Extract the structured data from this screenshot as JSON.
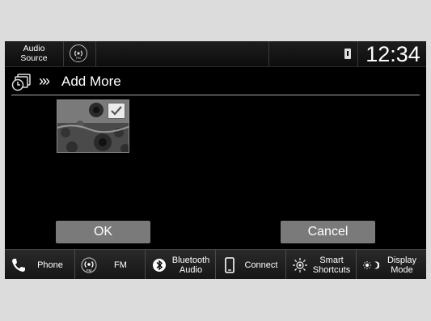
{
  "status_bar": {
    "audio_source_label": "Audio\nSource",
    "fm_icon": "fm-radio-icon",
    "usb_icon": "usb-icon",
    "clock": "12:34"
  },
  "header": {
    "icon": "clock-photo-icon",
    "chevrons": "»»",
    "title": "Add More"
  },
  "thumbnail": {
    "image": "sunflower-field-photo",
    "selected": true
  },
  "buttons": {
    "ok": "OK",
    "cancel": "Cancel"
  },
  "nav": [
    {
      "label": "Phone",
      "icon": "phone-icon"
    },
    {
      "label": "FM",
      "icon": "fm-radio-icon"
    },
    {
      "label": "Bluetooth\nAudio",
      "icon": "bluetooth-icon"
    },
    {
      "label": "Connect",
      "icon": "smartphone-icon"
    },
    {
      "label": "Smart\nShortcuts",
      "icon": "smart-shortcuts-icon"
    },
    {
      "label": "Display\nMode",
      "icon": "display-mode-icon"
    }
  ]
}
